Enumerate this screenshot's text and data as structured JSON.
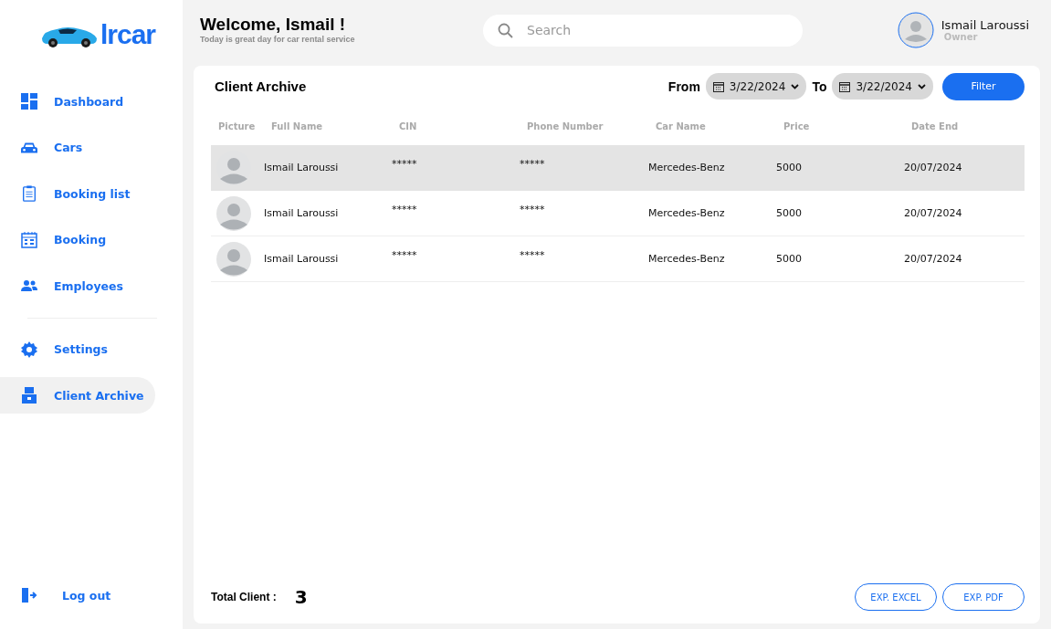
{
  "logo": {
    "text": "lrcar"
  },
  "sidebar": {
    "items": [
      {
        "label": "Dashboard",
        "selected": false
      },
      {
        "label": "Cars",
        "selected": false
      },
      {
        "label": "Booking list",
        "selected": false
      },
      {
        "label": "Booking",
        "selected": false
      },
      {
        "label": "Employees",
        "selected": false
      },
      {
        "label": "Settings",
        "selected": false
      },
      {
        "label": "Client Archive",
        "selected": true
      }
    ],
    "logout": {
      "label": "Log out"
    }
  },
  "header": {
    "title": "Welcome, Ismail !",
    "subtitle": "Today is great day for car rental service",
    "search": {
      "placeholder": "Search"
    },
    "user": {
      "name": "Ismail Laroussi",
      "role": "Owner"
    }
  },
  "card": {
    "title": "Client Archive",
    "from_label": "From",
    "from_date": "3/22/2024",
    "to_label": "To",
    "to_date": "3/22/2024",
    "filter_button": "Filter",
    "table": {
      "columns": [
        "Picture",
        "Full Name",
        "CIN",
        "Phone Number",
        "Car Name",
        "Price",
        "Date End"
      ],
      "rows": [
        {
          "full_name": "Ismail Laroussi",
          "cin": "*****",
          "phone": "*****",
          "car": "Mercedes-Benz",
          "price": "5000",
          "date_end": "20/07/2024",
          "selected": true
        },
        {
          "full_name": "Ismail Laroussi",
          "cin": "*****",
          "phone": "*****",
          "car": "Mercedes-Benz",
          "price": "5000",
          "date_end": "20/07/2024",
          "selected": false
        },
        {
          "full_name": "Ismail Laroussi",
          "cin": "*****",
          "phone": "*****",
          "car": "Mercedes-Benz",
          "price": "5000",
          "date_end": "20/07/2024",
          "selected": false
        }
      ]
    },
    "total_label": "Total Client :",
    "total_value": "3",
    "buttons": [
      "EXP. EXCEL",
      "EXP. PDF"
    ]
  }
}
